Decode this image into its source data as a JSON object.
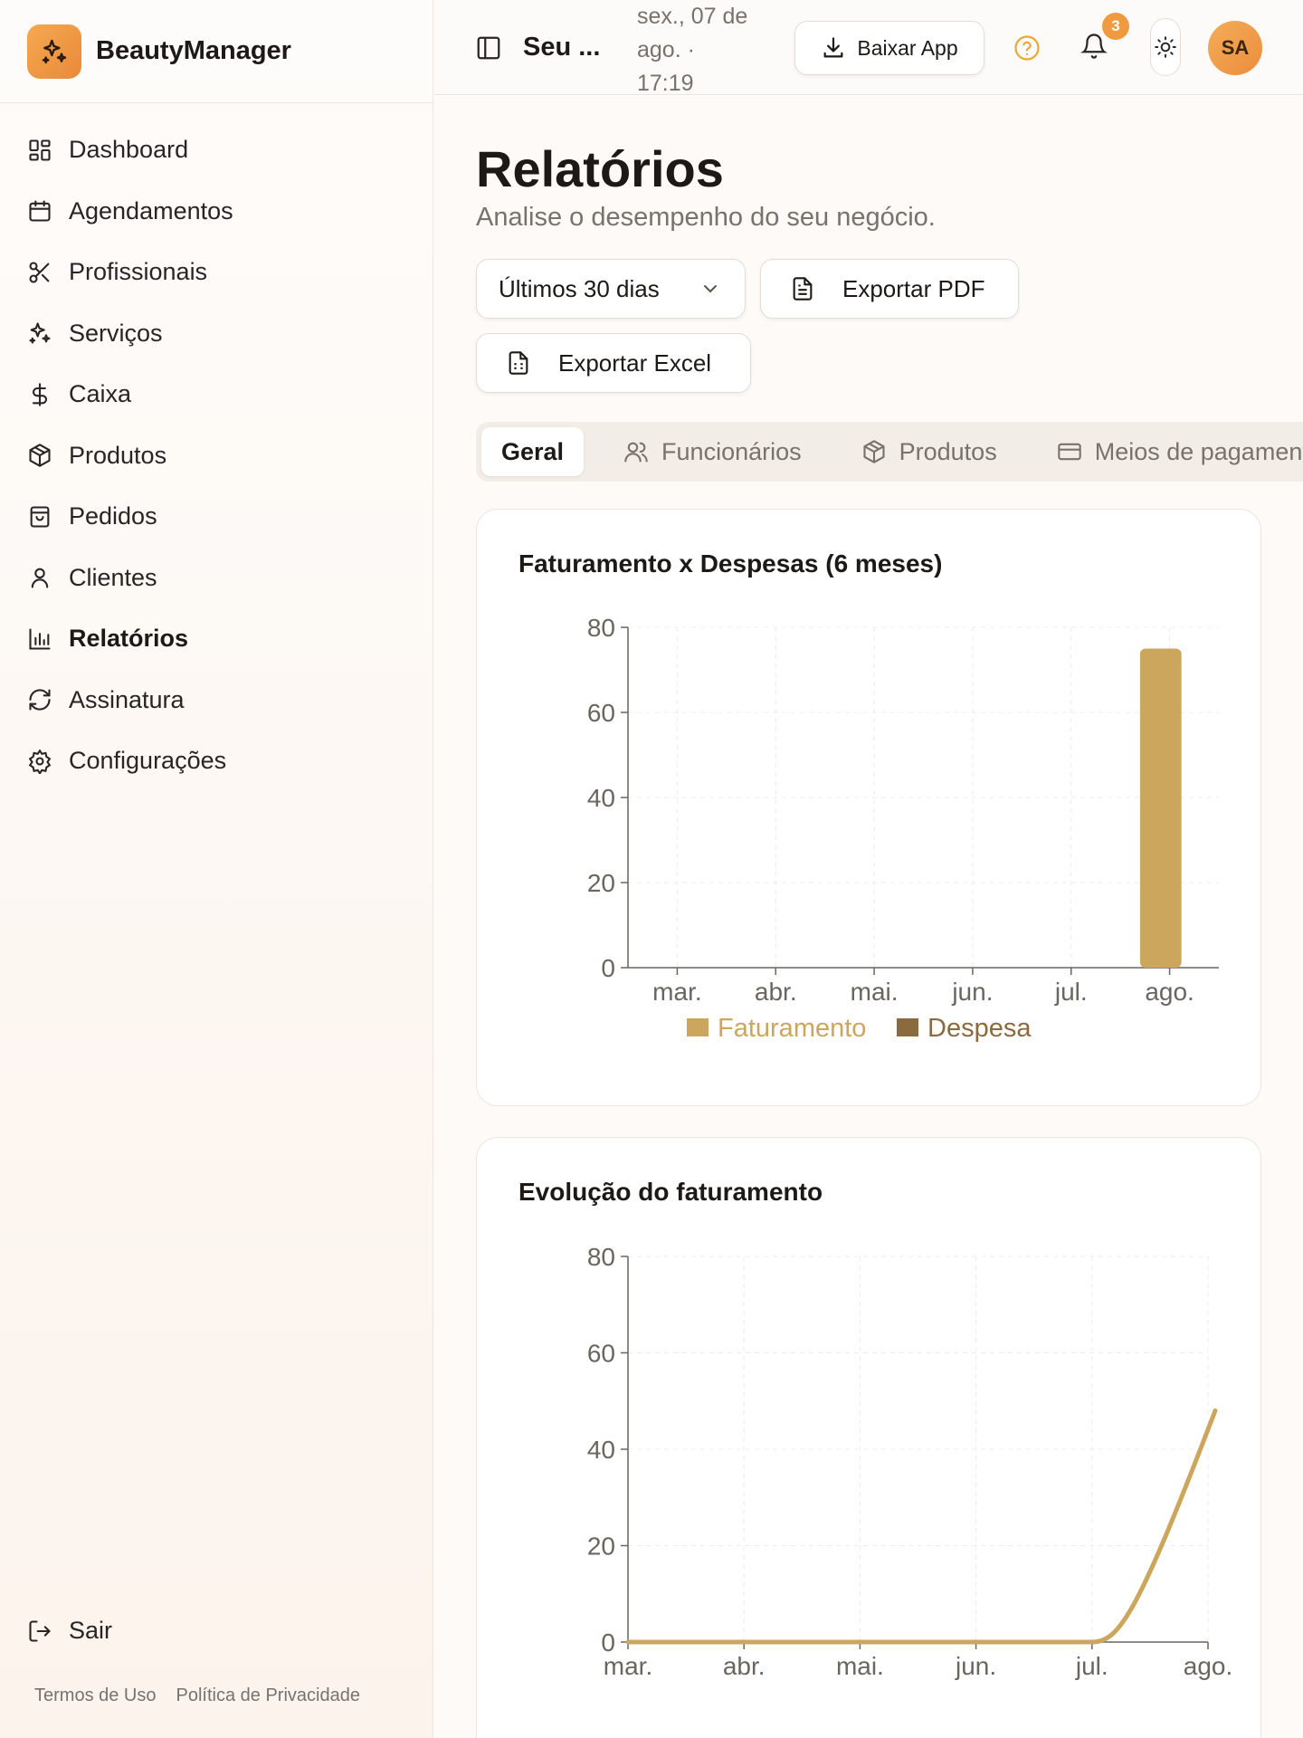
{
  "brand": {
    "name": "BeautyManager"
  },
  "sidebar": {
    "items": [
      {
        "label": "Dashboard",
        "icon": "dashboard-icon"
      },
      {
        "label": "Agendamentos",
        "icon": "calendar-icon"
      },
      {
        "label": "Profissionais",
        "icon": "scissors-icon"
      },
      {
        "label": "Serviços",
        "icon": "sparkles-icon"
      },
      {
        "label": "Caixa",
        "icon": "dollar-icon"
      },
      {
        "label": "Produtos",
        "icon": "package-icon"
      },
      {
        "label": "Pedidos",
        "icon": "shopping-bag-icon"
      },
      {
        "label": "Clientes",
        "icon": "user-icon"
      },
      {
        "label": "Relatórios",
        "icon": "bar-chart-icon",
        "active": true
      },
      {
        "label": "Assinatura",
        "icon": "refresh-icon"
      },
      {
        "label": "Configurações",
        "icon": "gear-icon"
      }
    ],
    "logout_label": "Sair",
    "terms_label": "Termos de Uso",
    "privacy_label": "Política de Privacidade"
  },
  "topbar": {
    "page_short": "Seu ...",
    "datetime_line1": "sex., 07 de",
    "datetime_line2": "ago. ·",
    "datetime_line3": "17:19",
    "download_label": "Baixar App",
    "notifications_count": "3",
    "avatar_initials": "SA"
  },
  "page": {
    "title": "Relatórios",
    "subtitle": "Analise o desempenho do seu negócio.",
    "period_label": "Últimos 30 dias",
    "export_pdf_label": "Exportar PDF",
    "export_excel_label": "Exportar Excel"
  },
  "tabs": [
    {
      "label": "Geral",
      "active": true
    },
    {
      "label": "Funcionários"
    },
    {
      "label": "Produtos"
    },
    {
      "label": "Meios de pagamento"
    }
  ],
  "colors": {
    "accent": "#ef9a3f",
    "faturamento": "#cda65d",
    "despesa": "#8b6a3e"
  },
  "chart_data": [
    {
      "type": "bar",
      "title": "Faturamento x Despesas (6 meses)",
      "categories": [
        "mar.",
        "abr.",
        "mai.",
        "jun.",
        "jul.",
        "ago."
      ],
      "series": [
        {
          "name": "Faturamento",
          "values": [
            0,
            0,
            0,
            0,
            0,
            75
          ]
        },
        {
          "name": "Despesa",
          "values": [
            0,
            0,
            0,
            0,
            0,
            0
          ]
        }
      ],
      "yticks": [
        0,
        20,
        40,
        60,
        80
      ],
      "ylim": [
        0,
        80
      ],
      "grid": true,
      "legend": "bottom"
    },
    {
      "type": "line",
      "title": "Evolução do faturamento",
      "categories": [
        "mar.",
        "abr.",
        "mai.",
        "jun.",
        "jul.",
        "ago."
      ],
      "series": [
        {
          "name": "Faturamento",
          "values": [
            0,
            0,
            0,
            0,
            0,
            48
          ]
        }
      ],
      "yticks": [
        0,
        20,
        40,
        60,
        80
      ],
      "ylim": [
        0,
        80
      ],
      "grid": true
    }
  ]
}
